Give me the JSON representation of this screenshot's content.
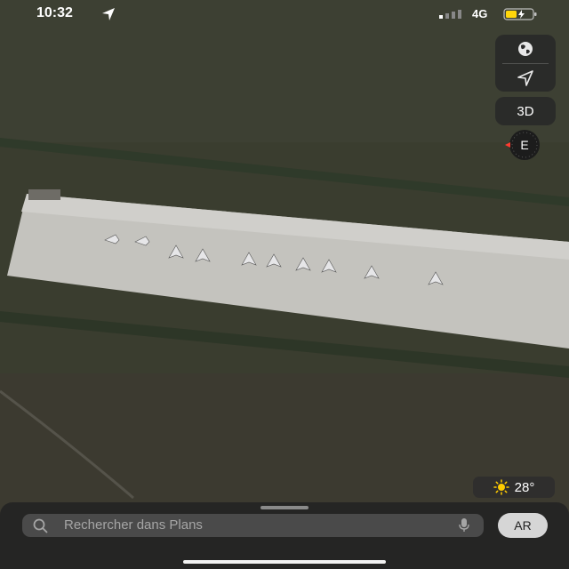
{
  "status_bar": {
    "time": "10:32",
    "network": "4G",
    "location_icon": "location-arrow-icon",
    "battery_color": "#ffd60a"
  },
  "map_controls": {
    "map_mode_icon": "globe-icon",
    "locate_icon": "location-arrow-icon",
    "three_d_label": "3D",
    "compass_label": "E",
    "compass_accent": "#ff3b30"
  },
  "weather": {
    "icon": "sun-icon",
    "temperature": "28°"
  },
  "search": {
    "placeholder": "Rechercher dans Plans",
    "icon": "search-icon",
    "mic_icon": "microphone-icon"
  },
  "ar_button": {
    "label": "AR"
  },
  "colors": {
    "grass": "#3a3d2f",
    "tarmac": "#c8c7c2",
    "panel": "#282828"
  }
}
